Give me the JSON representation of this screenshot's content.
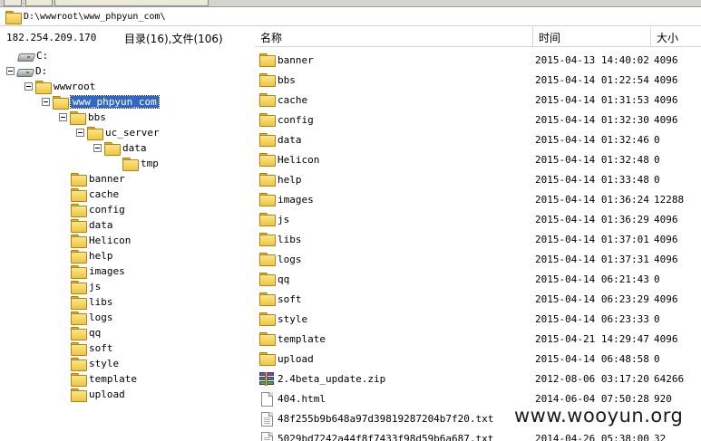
{
  "path": {
    "text": "D:\\wwwroot\\www_phpyun_com\\"
  },
  "status": {
    "ip": "182.254.209.170",
    "counts": "目录(16),文件(106)"
  },
  "tree": [
    {
      "label": "C:",
      "icon": "drive-icon",
      "indent": 0,
      "expander": false,
      "selected": false
    },
    {
      "label": "D:",
      "icon": "drive-icon",
      "indent": 0,
      "expander": true,
      "selected": false
    },
    {
      "label": "wwwroot",
      "icon": "folder-icon",
      "indent": 1,
      "expander": true,
      "selected": false
    },
    {
      "label": "www_phpyun_com",
      "icon": "folder-icon",
      "indent": 2,
      "expander": true,
      "selected": true
    },
    {
      "label": "bbs",
      "icon": "folder-icon",
      "indent": 3,
      "expander": true,
      "selected": false
    },
    {
      "label": "uc_server",
      "icon": "folder-icon",
      "indent": 4,
      "expander": true,
      "selected": false
    },
    {
      "label": "data",
      "icon": "folder-icon",
      "indent": 5,
      "expander": true,
      "selected": false
    },
    {
      "label": "tmp",
      "icon": "folder-icon",
      "indent": 6,
      "expander": false,
      "selected": false
    },
    {
      "label": "banner",
      "icon": "folder-icon",
      "indent": 3,
      "expander": false,
      "selected": false
    },
    {
      "label": "cache",
      "icon": "folder-icon",
      "indent": 3,
      "expander": false,
      "selected": false
    },
    {
      "label": "config",
      "icon": "folder-icon",
      "indent": 3,
      "expander": false,
      "selected": false
    },
    {
      "label": "data",
      "icon": "folder-icon",
      "indent": 3,
      "expander": false,
      "selected": false
    },
    {
      "label": "Helicon",
      "icon": "folder-icon",
      "indent": 3,
      "expander": false,
      "selected": false
    },
    {
      "label": "help",
      "icon": "folder-icon",
      "indent": 3,
      "expander": false,
      "selected": false
    },
    {
      "label": "images",
      "icon": "folder-icon",
      "indent": 3,
      "expander": false,
      "selected": false
    },
    {
      "label": "js",
      "icon": "folder-icon",
      "indent": 3,
      "expander": false,
      "selected": false
    },
    {
      "label": "libs",
      "icon": "folder-icon",
      "indent": 3,
      "expander": false,
      "selected": false
    },
    {
      "label": "logs",
      "icon": "folder-icon",
      "indent": 3,
      "expander": false,
      "selected": false
    },
    {
      "label": "qq",
      "icon": "folder-icon",
      "indent": 3,
      "expander": false,
      "selected": false
    },
    {
      "label": "soft",
      "icon": "folder-icon",
      "indent": 3,
      "expander": false,
      "selected": false
    },
    {
      "label": "style",
      "icon": "folder-icon",
      "indent": 3,
      "expander": false,
      "selected": false
    },
    {
      "label": "template",
      "icon": "folder-icon",
      "indent": 3,
      "expander": false,
      "selected": false
    },
    {
      "label": "upload",
      "icon": "folder-icon",
      "indent": 3,
      "expander": false,
      "selected": false
    }
  ],
  "columns": {
    "name": "名称",
    "time": "时间",
    "size": "大小"
  },
  "files": [
    {
      "icon": "folder-icon",
      "name": "banner",
      "time": "2015-04-13 14:40:02",
      "size": "4096"
    },
    {
      "icon": "folder-icon",
      "name": "bbs",
      "time": "2015-04-14 01:22:54",
      "size": "4096"
    },
    {
      "icon": "folder-icon",
      "name": "cache",
      "time": "2015-04-14 01:31:53",
      "size": "4096"
    },
    {
      "icon": "folder-icon",
      "name": "config",
      "time": "2015-04-14 01:32:30",
      "size": "4096"
    },
    {
      "icon": "folder-icon",
      "name": "data",
      "time": "2015-04-14 01:32:46",
      "size": "0"
    },
    {
      "icon": "folder-icon",
      "name": "Helicon",
      "time": "2015-04-14 01:32:48",
      "size": "0"
    },
    {
      "icon": "folder-icon",
      "name": "help",
      "time": "2015-04-14 01:33:48",
      "size": "0"
    },
    {
      "icon": "folder-icon",
      "name": "images",
      "time": "2015-04-14 01:36:24",
      "size": "12288"
    },
    {
      "icon": "folder-icon",
      "name": "js",
      "time": "2015-04-14 01:36:29",
      "size": "4096"
    },
    {
      "icon": "folder-icon",
      "name": "libs",
      "time": "2015-04-14 01:37:01",
      "size": "4096"
    },
    {
      "icon": "folder-icon",
      "name": "logs",
      "time": "2015-04-14 01:37:31",
      "size": "4096"
    },
    {
      "icon": "folder-icon",
      "name": "qq",
      "time": "2015-04-14 06:21:43",
      "size": "0"
    },
    {
      "icon": "folder-icon",
      "name": "soft",
      "time": "2015-04-14 06:23:29",
      "size": "4096"
    },
    {
      "icon": "folder-icon",
      "name": "style",
      "time": "2015-04-14 06:23:33",
      "size": "0"
    },
    {
      "icon": "folder-icon",
      "name": "template",
      "time": "2015-04-21 14:29:47",
      "size": "4096"
    },
    {
      "icon": "folder-icon",
      "name": "upload",
      "time": "2015-04-14 06:48:58",
      "size": "0"
    },
    {
      "icon": "zip-icon",
      "name": "2.4beta_update.zip",
      "time": "2012-08-06 03:17:20",
      "size": "64266"
    },
    {
      "icon": "file-icon",
      "name": "404.html",
      "time": "2014-06-04 07:50:28",
      "size": "920"
    },
    {
      "icon": "text-file-icon",
      "name": "48f255b9b648a97d39819287204b7f20.txt",
      "time": "",
      "size": ""
    },
    {
      "icon": "text-file-icon",
      "name": "5029bd7242a44f8f7433f98d59b6a687.txt",
      "time": "2014-04-26 05:38:00",
      "size": "32"
    }
  ],
  "watermark": "www.wooyun.org",
  "colors": {
    "selection": "#3168c6",
    "folder": "#f2c94a"
  }
}
